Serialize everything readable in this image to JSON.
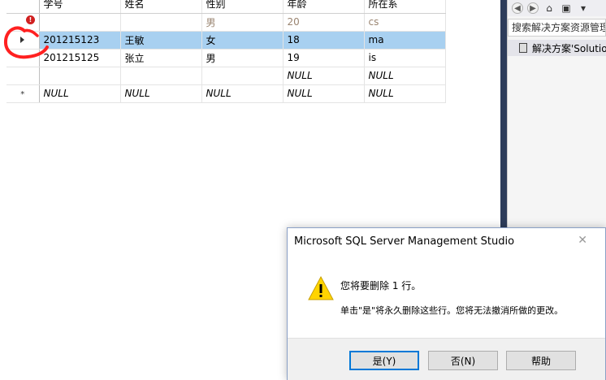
{
  "grid": {
    "columns": [
      "学号",
      "姓名",
      "性别",
      "年龄",
      "所在系"
    ],
    "rows": [
      {
        "state": "error",
        "cells": [
          "",
          "",
          "男",
          "20",
          "cs"
        ]
      },
      {
        "state": "current",
        "cells": [
          "201215123",
          "王敏",
          "女",
          "18",
          "ma"
        ]
      },
      {
        "state": "normal",
        "cells": [
          "201215125",
          "张立",
          "男",
          "19",
          "is"
        ]
      },
      {
        "state": "normal",
        "cells": [
          "",
          "",
          "",
          "NULL",
          "NULL"
        ]
      },
      {
        "state": "new",
        "cells": [
          "NULL",
          "NULL",
          "NULL",
          "NULL",
          "NULL"
        ]
      }
    ],
    "new_row_marker": "*",
    "error_marker": "!"
  },
  "explorer": {
    "search_placeholder": "搜索解决方案资源管理",
    "solution_label": "解决方案'Solutio"
  },
  "dialog": {
    "title": "Microsoft SQL Server Management Studio",
    "close_glyph": "✕",
    "message_line1": "您将要删除 1 行。",
    "message_line2": "单击\"是\"将永久删除这些行。您将无法撤消所做的更改。",
    "buttons": {
      "yes": "是(Y)",
      "no": "否(N)",
      "help": "帮助"
    }
  },
  "colors": {
    "selected_row": "#a8d0f0",
    "divider": "#2d3c5a",
    "annotation": "#ff2020",
    "warning": "#ffd400"
  }
}
